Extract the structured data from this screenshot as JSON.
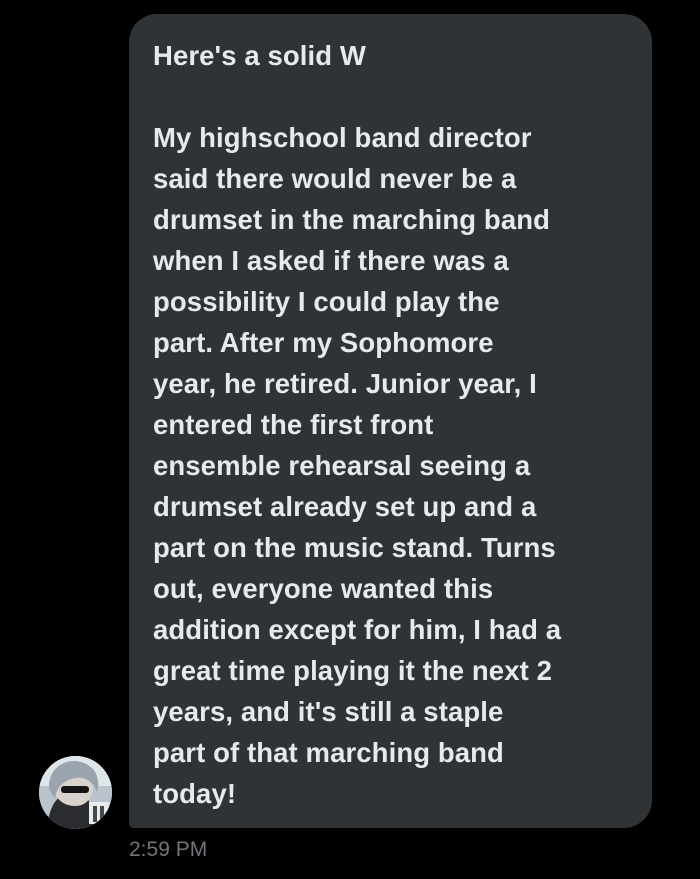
{
  "message": {
    "text": "Here's a solid W\n\nMy highschool band director\nsaid there would never be a\ndrumset in the marching band\nwhen I asked if there was a\npossibility I could play the\npart. After my Sophomore\nyear, he retired. Junior year, I\nentered the first front\nensemble rehearsal seeing a\ndrumset already set up and a\npart on the music stand. Turns\nout, everyone wanted this\naddition except for him, I had a\ngreat time playing it the next 2\nyears, and it's still a staple\npart of that marching band\ntoday!",
    "timestamp": "2:59 PM"
  },
  "colors": {
    "background": "#000000",
    "bubble": "#2f3336",
    "text": "#e7e9ea",
    "timestamp": "#71767b"
  },
  "icons": {
    "avatar": "profile-avatar-photo"
  }
}
